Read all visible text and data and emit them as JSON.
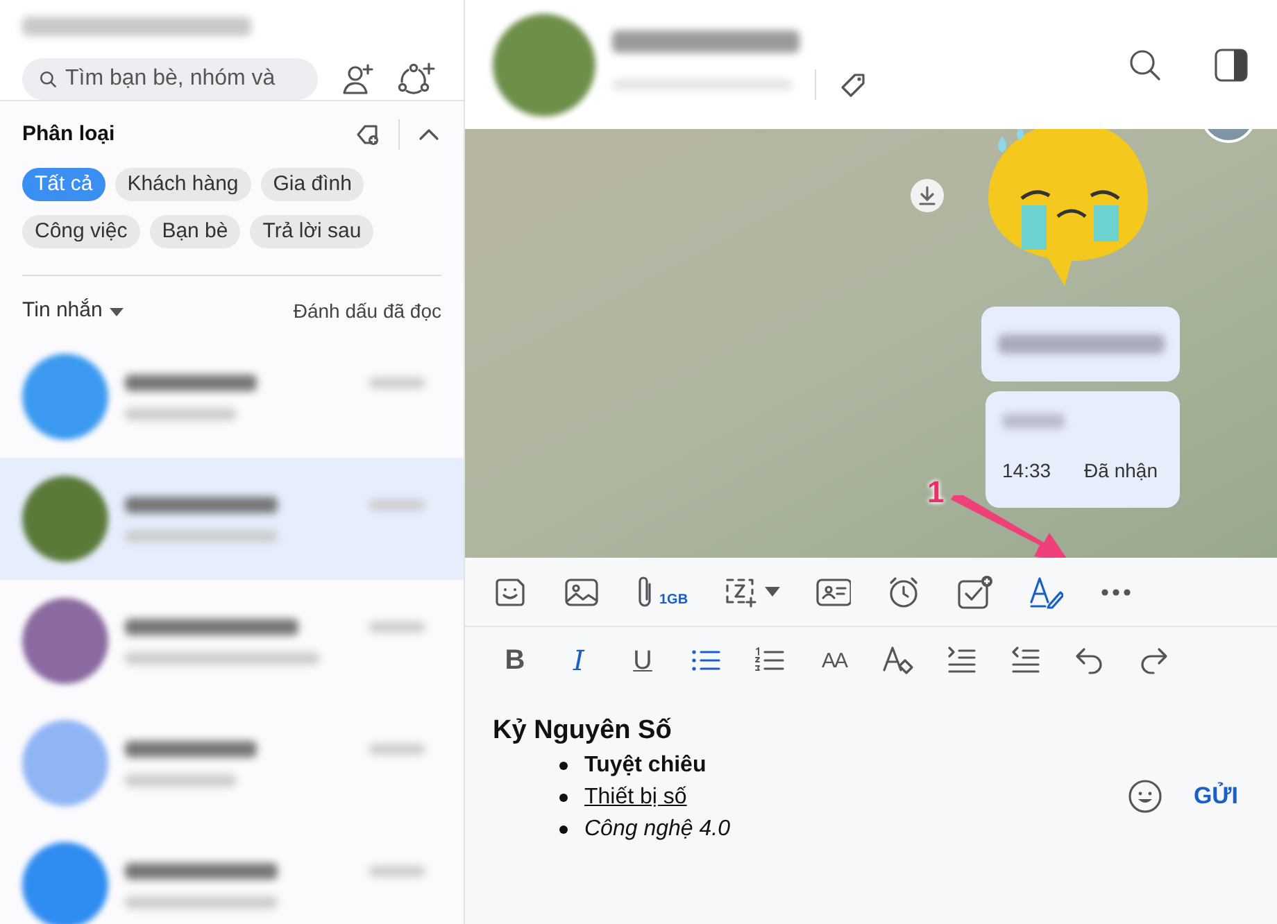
{
  "sidebar": {
    "search": {
      "placeholder": "Tìm bạn bè, nhóm và"
    },
    "category": {
      "title": "Phân loại",
      "expanded": true
    },
    "tags": [
      {
        "label": "Tất cả",
        "selected": true
      },
      {
        "label": "Khách hàng",
        "selected": false
      },
      {
        "label": "Gia đình",
        "selected": false
      },
      {
        "label": "Công việc",
        "selected": false
      },
      {
        "label": "Bạn bè",
        "selected": false
      },
      {
        "label": "Trả lời sau",
        "selected": false
      }
    ],
    "messages_filter": "Tin nhắn",
    "mark_read": "Đánh dấu đã đọc",
    "conversations": [
      {
        "selected": false,
        "color": "#3b9af0"
      },
      {
        "selected": true,
        "color": "#5a7a3a"
      },
      {
        "selected": false,
        "color": "#8a6aa0"
      },
      {
        "selected": false,
        "color": "#8fb5f5"
      },
      {
        "selected": false,
        "color": "#2f8cf0"
      }
    ]
  },
  "chat": {
    "bubbles": [
      {
        "kind": "text"
      },
      {
        "kind": "status",
        "time": "14:33",
        "status": "Đã nhận"
      }
    ],
    "annotation": "1",
    "toolbar": [
      {
        "kind": "sticker",
        "active": false
      },
      {
        "kind": "image",
        "active": false
      },
      {
        "kind": "attach",
        "label": "1GB",
        "active": false
      },
      {
        "kind": "capture",
        "active": false
      },
      {
        "kind": "card",
        "active": false
      },
      {
        "kind": "alarm",
        "active": false
      },
      {
        "kind": "task",
        "active": false
      },
      {
        "kind": "format",
        "active": true
      },
      {
        "kind": "more",
        "active": false
      }
    ],
    "format_tools": [
      {
        "kind": "bold",
        "label": "B",
        "active": false
      },
      {
        "kind": "italic",
        "label": "I",
        "active": true
      },
      {
        "kind": "underline",
        "label": "U",
        "active": false
      },
      {
        "kind": "bullets",
        "active": true
      },
      {
        "kind": "numbers",
        "active": false
      },
      {
        "kind": "size",
        "label": "AA",
        "active": false
      },
      {
        "kind": "clear",
        "active": false
      },
      {
        "kind": "indent",
        "active": false
      },
      {
        "kind": "outdent",
        "active": false
      },
      {
        "kind": "undo",
        "active": false
      },
      {
        "kind": "redo",
        "active": false
      }
    ],
    "composer": {
      "heading": "Kỷ Nguyên Số",
      "items": [
        {
          "kind": "bold",
          "text": "Tuyệt chiêu"
        },
        {
          "kind": "underline",
          "text": "Thiết bị số"
        },
        {
          "kind": "italic",
          "text": "Công nghệ 4.0"
        }
      ],
      "send": "GỬI"
    }
  }
}
